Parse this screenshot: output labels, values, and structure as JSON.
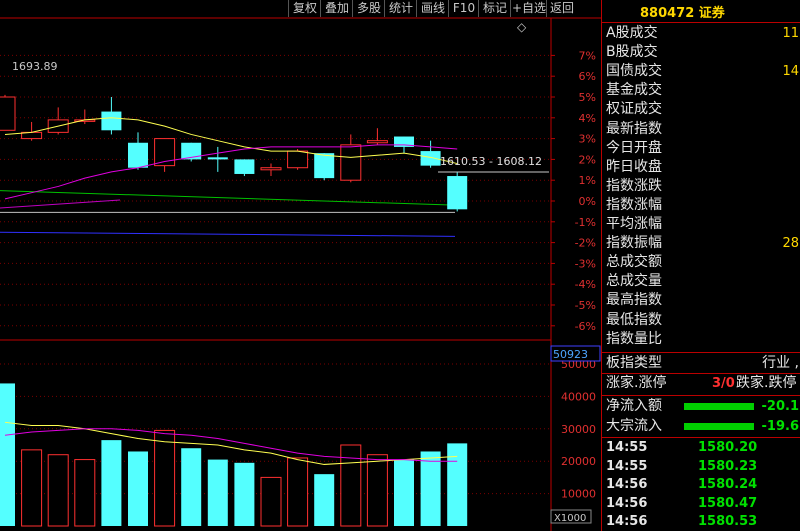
{
  "toolbar": {
    "buttons": [
      "复权",
      "叠加",
      "多股",
      "统计",
      "画线",
      "F10",
      "标记",
      "+自选",
      "返回"
    ]
  },
  "chart_labels": {
    "diamond": "◇",
    "prev_high": "1693.89",
    "range_label": "1610.53 - 1608.12",
    "volume_max": "50923",
    "volume_unit": "X1000"
  },
  "chart_data": [
    {
      "type": "candlestick",
      "y_ticks_percent": [
        "7%",
        "6%",
        "5%",
        "4%",
        "3%",
        "2%",
        "1%",
        "0%",
        "-1%",
        "-2%",
        "-3%",
        "-4%",
        "-5%",
        "-6%"
      ],
      "candles_percent": [
        {
          "open": 3.4,
          "close": 5.0,
          "high": 5.1,
          "low": 3.4
        },
        {
          "open": 3.0,
          "close": 3.3,
          "high": 3.8,
          "low": 2.9
        },
        {
          "open": 3.3,
          "close": 3.9,
          "high": 4.5,
          "low": 3.2
        },
        {
          "open": 3.9,
          "close": 3.9,
          "high": 4.4,
          "low": 3.7
        },
        {
          "open": 4.3,
          "close": 3.4,
          "high": 5.0,
          "low": 3.2
        },
        {
          "open": 2.8,
          "close": 1.6,
          "high": 3.3,
          "low": 1.5
        },
        {
          "open": 1.7,
          "close": 3.0,
          "high": 3.0,
          "low": 1.4
        },
        {
          "open": 2.8,
          "close": 2.0,
          "high": 2.8,
          "low": 1.9
        },
        {
          "open": 2.1,
          "close": 2.0,
          "high": 2.6,
          "low": 1.4
        },
        {
          "open": 2.0,
          "close": 1.3,
          "high": 2.0,
          "low": 1.2
        },
        {
          "open": 1.5,
          "close": 1.6,
          "high": 1.8,
          "low": 1.2
        },
        {
          "open": 1.6,
          "close": 2.4,
          "high": 2.5,
          "low": 1.5
        },
        {
          "open": 2.3,
          "close": 1.1,
          "high": 2.3,
          "low": 1.0
        },
        {
          "open": 1.0,
          "close": 2.7,
          "high": 3.2,
          "low": 0.9
        },
        {
          "open": 2.8,
          "close": 2.9,
          "high": 3.5,
          "low": 2.7
        },
        {
          "open": 3.1,
          "close": 2.6,
          "high": 3.1,
          "low": 2.3
        },
        {
          "open": 2.4,
          "close": 1.7,
          "high": 2.9,
          "low": 1.6
        },
        {
          "open": 1.2,
          "close": -0.4,
          "high": 1.4,
          "low": -0.5
        }
      ],
      "ma_yellow": [
        3.2,
        3.3,
        3.6,
        3.9,
        4.0,
        3.9,
        3.6,
        3.2,
        2.9,
        2.6,
        2.4,
        2.4,
        2.2,
        2.1,
        2.2,
        2.3,
        2.1,
        1.8
      ],
      "ma_magenta": [
        0.1,
        0.4,
        0.7,
        1.1,
        1.4,
        1.6,
        1.9,
        2.1,
        2.3,
        2.5,
        2.6,
        2.6,
        2.6,
        2.6,
        2.7,
        2.7,
        2.6,
        2.5
      ],
      "ma_green_start": 0.5,
      "ma_green_end": -0.2,
      "ma_white_start": -0.4,
      "ma_white_end": -0.4,
      "ma_blue_start": -1.5,
      "ma_blue_end": -1.7
    },
    {
      "type": "bar",
      "y_ticks": [
        "50000",
        "40000",
        "30000",
        "20000",
        "10000"
      ],
      "ylim": [
        0,
        50923
      ],
      "values": [
        44000,
        23500,
        22000,
        20500,
        26500,
        23000,
        29500,
        24000,
        20500,
        19500,
        15000,
        21000,
        16000,
        25000,
        22000,
        20500,
        23000,
        25500
      ],
      "colors": [
        "cyan",
        "red",
        "red",
        "red",
        "cyan",
        "cyan",
        "red",
        "cyan",
        "cyan",
        "cyan",
        "red",
        "red",
        "cyan",
        "red",
        "red",
        "cyan",
        "cyan",
        "cyan"
      ],
      "vol_ma_yellow": [
        32000,
        31000,
        31000,
        30000,
        28500,
        27000,
        26000,
        25500,
        25000,
        23500,
        22500,
        20500,
        19000,
        19500,
        20000,
        20500,
        21000,
        21500
      ],
      "vol_ma_magenta": [
        28000,
        29000,
        29500,
        30000,
        30000,
        29500,
        28500,
        28000,
        27000,
        25500,
        24000,
        22500,
        21500,
        21000,
        20500,
        20500,
        20000,
        20000
      ]
    }
  ],
  "panel": {
    "title": "880472 证券",
    "rows": [
      {
        "label": "A股成交",
        "value": "11"
      },
      {
        "label": "B股成交",
        "value": ""
      },
      {
        "label": "国债成交",
        "value": "14"
      },
      {
        "label": "基金成交",
        "value": ""
      },
      {
        "label": "权证成交",
        "value": ""
      },
      {
        "label": "最新指数",
        "value": ""
      },
      {
        "label": "今日开盘",
        "value": ""
      },
      {
        "label": "昨日收盘",
        "value": ""
      },
      {
        "label": "指数涨跌",
        "value": ""
      },
      {
        "label": "指数涨幅",
        "value": ""
      },
      {
        "label": "平均涨幅",
        "value": ""
      },
      {
        "label": "指数振幅",
        "value": "28"
      },
      {
        "label": "总成交额",
        "value": ""
      },
      {
        "label": "总成交量",
        "value": ""
      },
      {
        "label": "最高指数",
        "value": ""
      },
      {
        "label": "最低指数",
        "value": ""
      },
      {
        "label": "指数量比",
        "value": ""
      }
    ],
    "type_label": "板指类型",
    "type_value": "行业 ,",
    "up_label": "涨家.涨停",
    "up_value": "3/0",
    "down_label": "跌家.跌停",
    "flow": [
      {
        "label": "净流入额",
        "value": "-20.1"
      },
      {
        "label": "大宗流入",
        "value": "-19.6"
      }
    ],
    "ticks": [
      {
        "time": "14:55",
        "price": "1580.20"
      },
      {
        "time": "14:55",
        "price": "1580.23"
      },
      {
        "time": "14:56",
        "price": "1580.24"
      },
      {
        "time": "14:56",
        "price": "1580.47"
      },
      {
        "time": "14:56",
        "price": "1580.53"
      }
    ]
  }
}
